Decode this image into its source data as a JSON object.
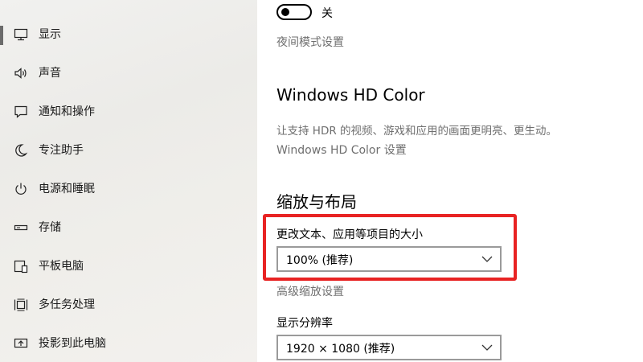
{
  "sidebar": {
    "items": [
      {
        "label": "显示",
        "icon": "monitor-icon"
      },
      {
        "label": "声音",
        "icon": "speaker-icon"
      },
      {
        "label": "通知和操作",
        "icon": "notification-icon"
      },
      {
        "label": "专注助手",
        "icon": "moon-icon"
      },
      {
        "label": "电源和睡眠",
        "icon": "power-icon"
      },
      {
        "label": "存储",
        "icon": "storage-icon"
      },
      {
        "label": "平板电脑",
        "icon": "tablet-icon"
      },
      {
        "label": "多任务处理",
        "icon": "multitask-icon"
      },
      {
        "label": "投影到此电脑",
        "icon": "project-icon"
      }
    ]
  },
  "night_light": {
    "toggle_state": "关",
    "settings_link": "夜间模式设置"
  },
  "hd_color": {
    "title": "Windows HD Color",
    "description": "让支持 HDR 的视频、游戏和应用的画面更明亮、更生动。",
    "settings_link": "Windows HD Color 设置"
  },
  "scale_layout": {
    "title": "缩放与布局",
    "scale_label": "更改文本、应用等项目的大小",
    "scale_value": "100% (推荐)",
    "advanced_link": "高级缩放设置",
    "resolution_label": "显示分辨率",
    "resolution_value": "1920 × 1080 (推荐)"
  },
  "colors": {
    "highlight": "#e82323"
  }
}
